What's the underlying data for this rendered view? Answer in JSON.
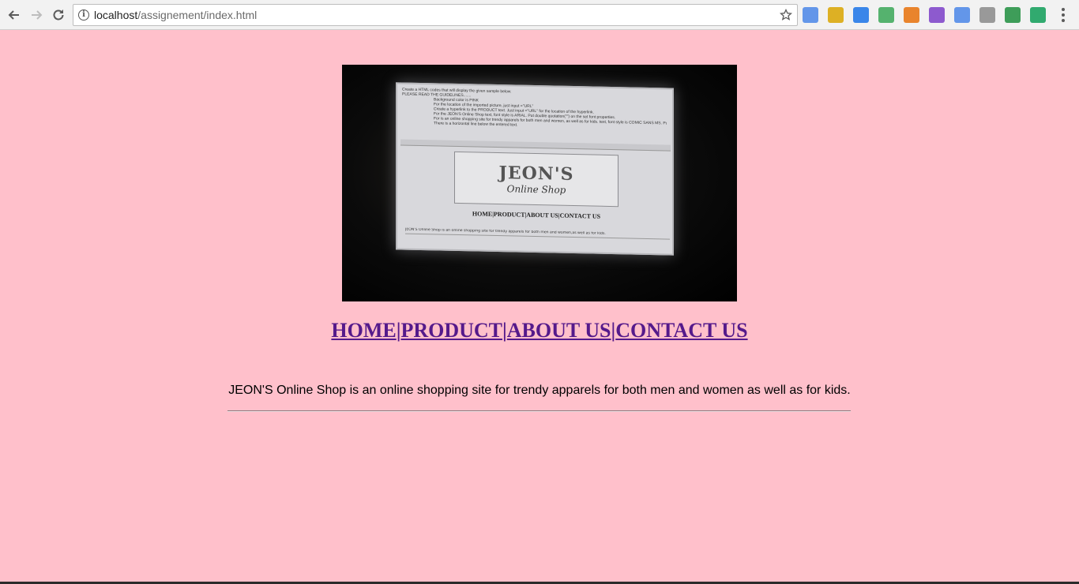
{
  "browser": {
    "url_host": "localhost",
    "url_path": "/assignement/index.html",
    "extensions": [
      {
        "icon": "google-docs-icon",
        "color": "#4a86e8"
      },
      {
        "icon": "google-sheets-icon",
        "color": "#d9a400"
      },
      {
        "icon": "search-extension-icon",
        "color": "#1a73e8"
      },
      {
        "icon": "clip-icon",
        "color": "#3aa757"
      },
      {
        "icon": "flag-icon",
        "color": "#e8710a"
      },
      {
        "icon": "drop-icon",
        "color": "#7b3fc8"
      },
      {
        "icon": "circle-extension-icon",
        "color": "#4a86e8"
      },
      {
        "icon": "magnifier-icon",
        "color": "#8a8a8a"
      },
      {
        "icon": "green-search-icon",
        "color": "#1e8e3e"
      },
      {
        "icon": "music-note-icon",
        "color": "#0f9d58"
      }
    ]
  },
  "page": {
    "background": "#ffc0cb",
    "banner": {
      "instructions": [
        "Create a HTML codes that will display the given sample below.",
        "PLEASE READ THE GUIDELINES.......",
        "Background color is PINK",
        "For the location of the imported picture, just input =\"URL\"",
        "Create a hyperlink to the PRODUCT text. Just input =\"URL\" for the location of the hyperlink.",
        "For the JEON'S Online Shop text, font style is ARIAL. Put double quotation(\"\") on the set font properties.",
        "For is an online shopping site for trendy apparels for both men and women, as well as for kids. text, font style is COMIC SANS MS. Put double quotation(\"\") on the set font properties.",
        "There is a horizontal line below the entered text."
      ],
      "logo_title": "JEON'S",
      "logo_subtitle": "Online Shop",
      "mini_nav": "HOME|PRODUCT|ABOUT US|CONTACT US",
      "mini_desc": "JEON'S Online Shop is an online shopping site for trendy apparels for both men and women,as well as for kids."
    },
    "nav": {
      "home": "HOME",
      "product": "PRODUCT",
      "about": "ABOUT US",
      "contact": "CONTACT US",
      "separator": "|"
    },
    "description": "JEON'S Online Shop is an online shopping site for trendy apparels for both men and women as well as for kids."
  }
}
